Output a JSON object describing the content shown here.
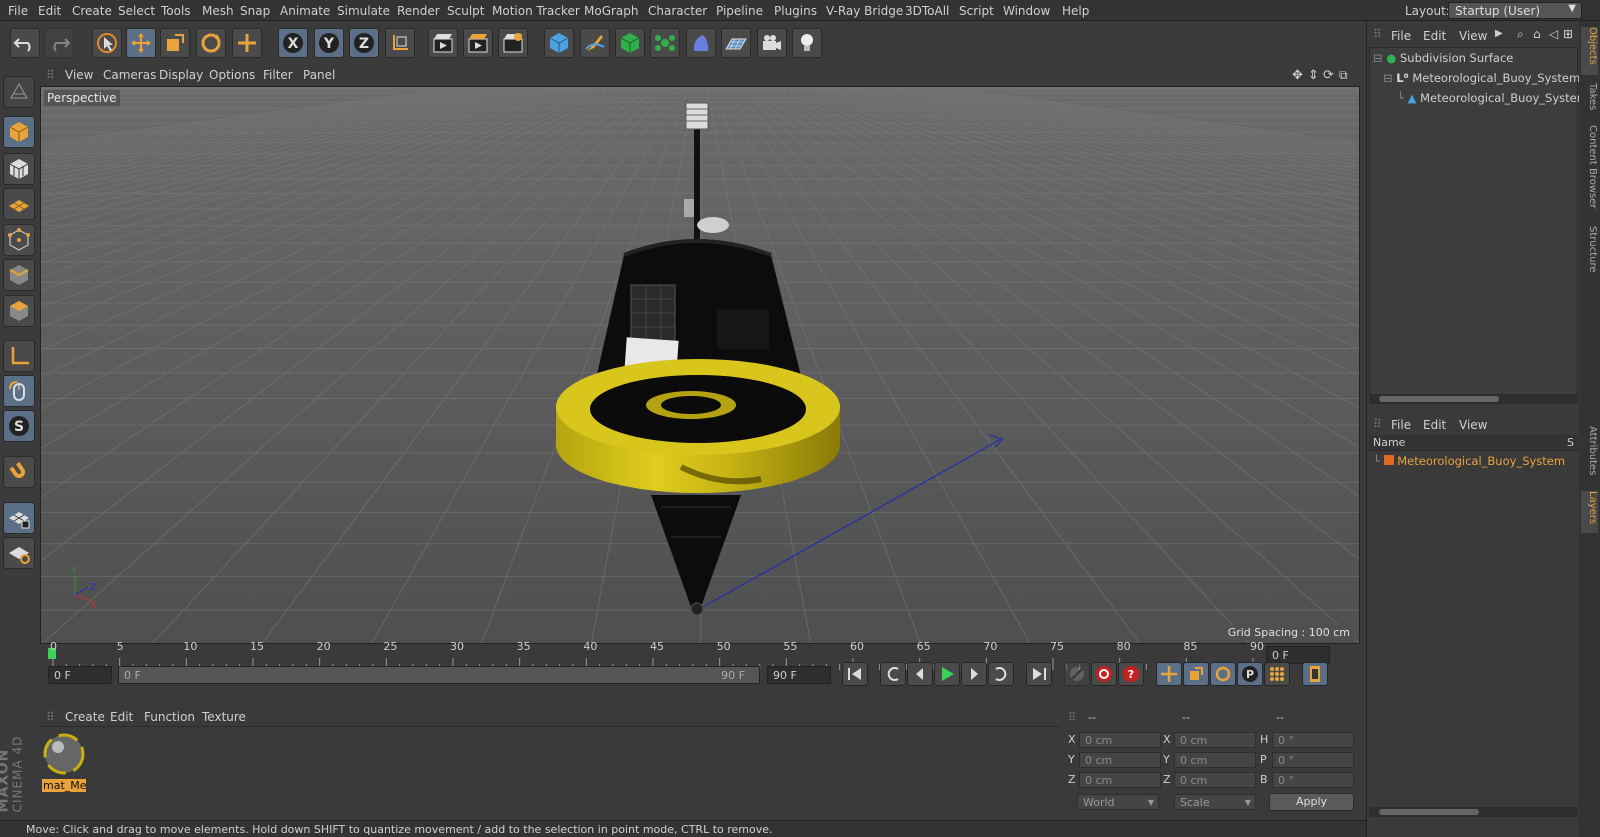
{
  "menubar": {
    "items": [
      "File",
      "Edit",
      "Create",
      "Select",
      "Tools",
      "Mesh",
      "Snap",
      "Animate",
      "Simulate",
      "Render",
      "Sculpt",
      "Motion Tracker",
      "MoGraph",
      "Character",
      "Pipeline",
      "Plugins",
      "V-Ray Bridge",
      "3DToAll",
      "Script",
      "Window",
      "Help"
    ],
    "layout_label": "Layout:",
    "layout_value": "Startup (User)"
  },
  "viewport": {
    "menu": [
      "View",
      "Cameras",
      "Display",
      "Options",
      "Filter",
      "Panel"
    ],
    "label": "Perspective",
    "grid_spacing": "Grid Spacing : 100 cm"
  },
  "timeline": {
    "ticks": [
      "0",
      "5",
      "10",
      "15",
      "20",
      "25",
      "30",
      "35",
      "40",
      "45",
      "50",
      "55",
      "60",
      "65",
      "70",
      "75",
      "80",
      "85",
      "90"
    ],
    "end_field": "0 F",
    "current_frame": "0 F",
    "range_start": "0 F",
    "range_end_inner": "90 F",
    "range_end": "90 F"
  },
  "material_manager": {
    "menu": [
      "Create",
      "Edit",
      "Function",
      "Texture"
    ],
    "material_name": "mat_Me"
  },
  "coordinates": {
    "header": [
      "--",
      "--",
      "--"
    ],
    "rows": [
      {
        "a_label": "X",
        "a_val": "0 cm",
        "b_label": "X",
        "b_val": "0 cm",
        "c_label": "H",
        "c_val": "0 °"
      },
      {
        "a_label": "Y",
        "a_val": "0 cm",
        "b_label": "Y",
        "b_val": "0 cm",
        "c_label": "P",
        "c_val": "0 °"
      },
      {
        "a_label": "Z",
        "a_val": "0 cm",
        "b_label": "Z",
        "b_val": "0 cm",
        "c_label": "B",
        "c_val": "0 °"
      }
    ],
    "mode_world": "World",
    "mode_scale": "Scale",
    "apply": "Apply"
  },
  "status": "Move: Click and drag to move elements. Hold down SHIFT to quantize movement / add to the selection in point mode, CTRL to remove.",
  "object_manager": {
    "menu": [
      "File",
      "Edit",
      "View"
    ],
    "objects": [
      "Subdivision Surface",
      "Meteorological_Buoy_System",
      "Meteorological_Buoy_System_("
    ]
  },
  "layer_manager": {
    "menu": [
      "File",
      "Edit",
      "View"
    ],
    "col_name": "Name",
    "col_s": "S",
    "layers": [
      "Meteorological_Buoy_System"
    ]
  },
  "side_tabs": [
    "Objects",
    "Takes",
    "Content Browser",
    "Structure",
    "Attributes",
    "Layers"
  ],
  "logo": {
    "line1": "MAXON",
    "line2": "CINEMA 4D"
  },
  "colors": {
    "accent": "#e8a33a",
    "active_tool": "#5b6f87",
    "buoy_yellow": "#d6c21a"
  }
}
